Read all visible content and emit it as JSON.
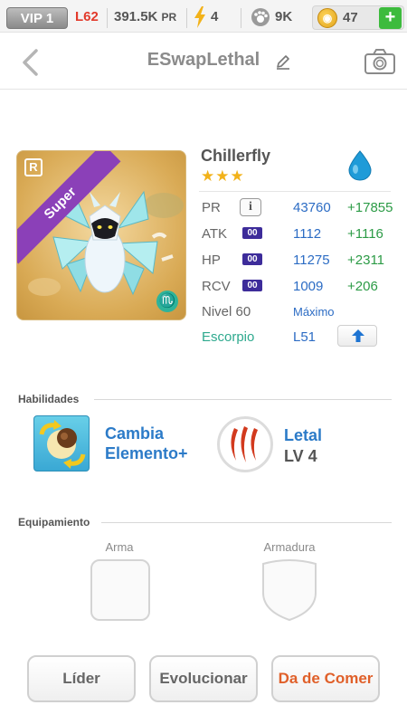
{
  "statusbar": {
    "vip": "VIP 1",
    "level": "L62",
    "pr": "391.5K",
    "pr_unit": "PR",
    "energy": "4",
    "paws": "9K",
    "coins": "47",
    "plus": "+",
    "icons": [
      "lightning-icon",
      "paw-icon",
      "coin-icon",
      "plus-icon"
    ]
  },
  "header": {
    "title": "ESwapLethal",
    "icons": [
      "back-arrow-icon",
      "edit-pencil-icon",
      "camera-icon"
    ]
  },
  "monster": {
    "name": "Chillerfly",
    "rarity_badge": "Super",
    "rarity_letter": "R",
    "stars": "★★★",
    "star_count": 3,
    "element": "water",
    "zodiac_symbol": "♏",
    "stats": [
      {
        "label": "PR",
        "value": "43760",
        "bonus": "+17855"
      },
      {
        "label": "ATK",
        "badge": "00",
        "value": "1112",
        "bonus": "+1116"
      },
      {
        "label": "HP",
        "badge": "00",
        "value": "11275",
        "bonus": "+2311"
      },
      {
        "label": "RCV",
        "badge": "00",
        "value": "1009",
        "bonus": "+206"
      }
    ],
    "info_label": "i",
    "level_label": "Nivel 60",
    "level_status": "Máximo",
    "zodiac_name": "Escorpio",
    "zodiac_level": "L51"
  },
  "skills": {
    "title": "Habilidades",
    "items": [
      {
        "name_line1": "Cambia",
        "name_line2": "Elemento+",
        "icon": "element-swap-icon"
      },
      {
        "name_line1": "Letal",
        "level": "LV 4",
        "icon": "claw-marks-icon"
      }
    ]
  },
  "equipment": {
    "title": "Equipamiento",
    "weapon_label": "Arma",
    "armor_label": "Armadura"
  },
  "actions": {
    "leader": "Líder",
    "evolve": "Evolucionar",
    "feed": "Da de Comer"
  },
  "colors": {
    "accent_blue": "#2c6cc4",
    "bonus_green": "#2c9b46",
    "feed_orange": "#e0602a",
    "super_purple": "#8b40b8"
  }
}
